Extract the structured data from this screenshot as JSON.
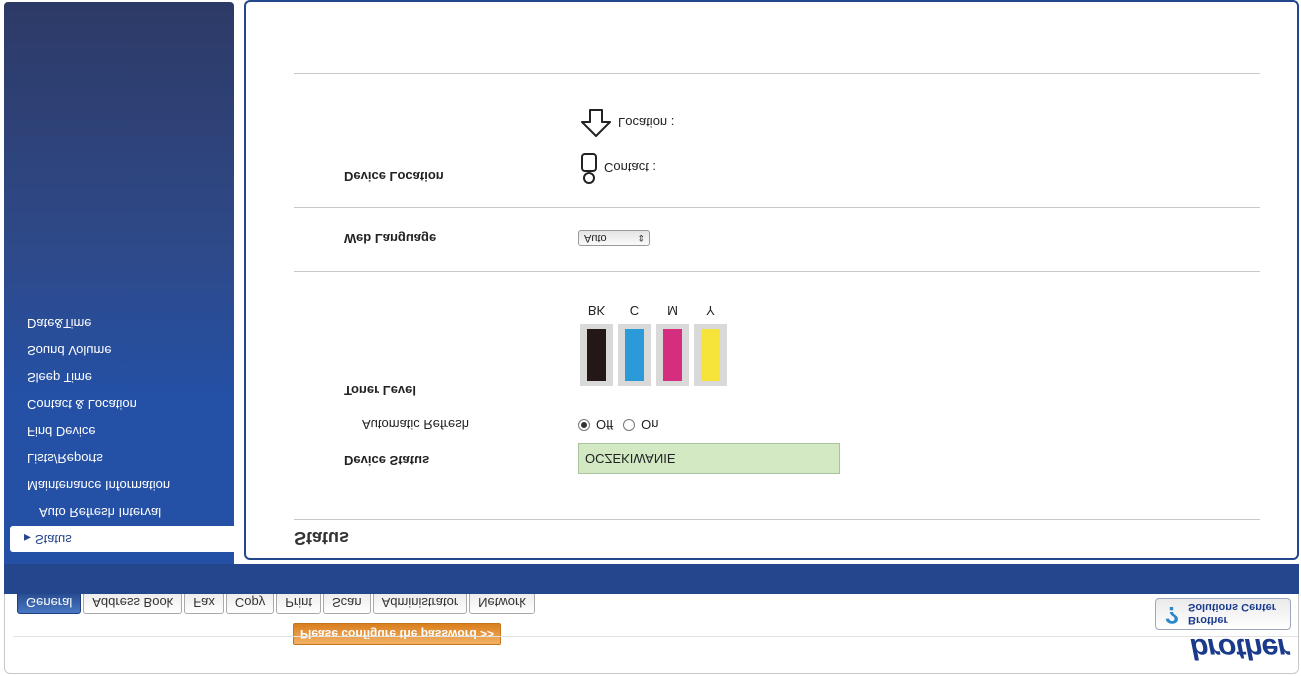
{
  "header": {
    "logo": "brother",
    "password_banner": "Please configure the password >>",
    "solutions_line1": "Brother",
    "solutions_line2": "Solutions Center",
    "solutions_icon": "question-mark-icon"
  },
  "tabs": [
    {
      "label": "General",
      "active": true
    },
    {
      "label": "Address Book"
    },
    {
      "label": "Fax"
    },
    {
      "label": "Copy"
    },
    {
      "label": "Print"
    },
    {
      "label": "Scan"
    },
    {
      "label": "Administrator"
    },
    {
      "label": "Network"
    }
  ],
  "sidebar": {
    "items": [
      {
        "label": "Status",
        "active": true
      },
      {
        "label": "Auto Refresh Interval",
        "sub": true
      },
      {
        "label": "Maintenance Information"
      },
      {
        "label": "Lists/Reports"
      },
      {
        "label": "Find Device"
      },
      {
        "label": "Contact & Location"
      },
      {
        "label": "Sleep Time"
      },
      {
        "label": "Sound Volume"
      },
      {
        "label": "Date&Time"
      }
    ]
  },
  "main": {
    "title": "Status",
    "device_status_label": "Device Status",
    "device_status_value": "OCZEKIWANIE",
    "auto_refresh_label": "Automatic Refresh",
    "auto_refresh_off": "Off",
    "auto_refresh_on": "On",
    "auto_refresh_selected": "Off",
    "toner_label": "Toner Level",
    "toner": [
      {
        "name": "BK",
        "color": "#231815",
        "level": 1.0
      },
      {
        "name": "C",
        "color": "#2a9ad8",
        "level": 1.0
      },
      {
        "name": "M",
        "color": "#d52e7e",
        "level": 1.0
      },
      {
        "name": "Y",
        "color": "#f6e43a",
        "level": 1.0
      }
    ],
    "web_language_label": "Web Language",
    "web_language_value": "Auto",
    "device_location_label": "Device Location",
    "contact_label": "Contact :",
    "location_label": "Location :"
  },
  "colors": {
    "brand_blue": "#24468c",
    "status_green": "#d3e9c4",
    "banner_orange": "#e8953a"
  }
}
